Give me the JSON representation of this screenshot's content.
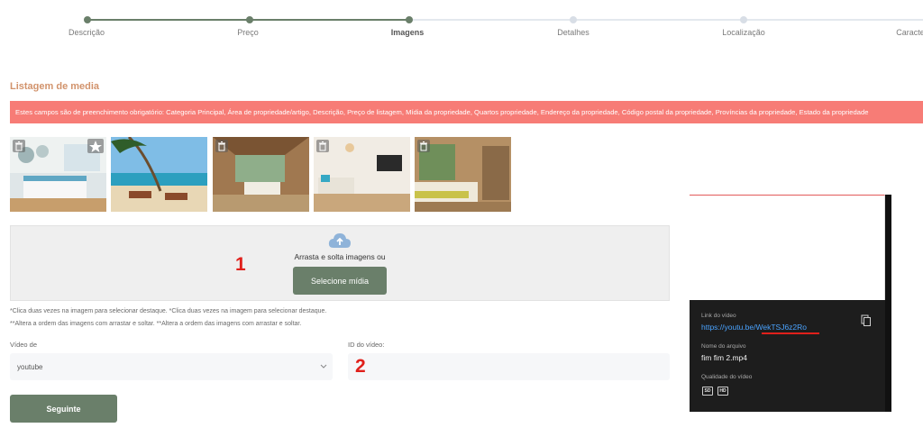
{
  "steps": [
    {
      "label": "Descrição",
      "state": "done"
    },
    {
      "label": "Preço",
      "state": "done"
    },
    {
      "label": "Imagens",
      "state": "active"
    },
    {
      "label": "Detalhes",
      "state": "todo"
    },
    {
      "label": "Localização",
      "state": "todo"
    },
    {
      "label": "Caracte",
      "state": "todo"
    }
  ],
  "section_title": "Listagem de media",
  "alert_text": "Estes campos são de preenchimento obrigatório: Categoria Principal, Área de propriedade/artigo, Descrição, Preço de listagem, Mídia da propriedade, Quartos propriedade, Endereço da propriedade, Código postal da propriedade, Províncias da propriedade, Estado da propriedade",
  "thumbnails": [
    {
      "icon": "bedroom-photo",
      "featured": true
    },
    {
      "icon": "beach-photo",
      "featured": false
    },
    {
      "icon": "room-photo",
      "featured": false
    },
    {
      "icon": "living-room-photo",
      "featured": false
    },
    {
      "icon": "bedroom-photo",
      "featured": false
    }
  ],
  "dropzone": {
    "text": "Arrasta e solta imagens ou",
    "button": "Selecione mídia",
    "icon": "cloud-upload-icon"
  },
  "hints": {
    "line1": "*Clica duas vezes na imagem para selecionar destaque. *Clica duas vezes na imagem para selecionar destaque.",
    "line2": "**Altera a ordem das imagens com arrastar e soltar. **Altera a ordem das imagens com arrastar e soltar."
  },
  "video_from": {
    "label": "Vídeo de",
    "value": "youtube"
  },
  "video_id": {
    "label": "ID do vídeo:",
    "value": ""
  },
  "next_button": "Seguinte",
  "annotations": {
    "one": "1",
    "two": "2"
  },
  "youtube_panel": {
    "link_label": "Link do vídeo",
    "link": "https://youtu.be/WekTSJ6z2Ro",
    "file_label": "Nome do arquivo",
    "file_name": "fim fim 2.mp4",
    "quality_label": "Qualidade do vídeo",
    "quality_badges": [
      "SD",
      "HD"
    ]
  },
  "colors": {
    "accent": "#6a7f6a",
    "alert": "#f77c76",
    "title": "#d2936c",
    "annotation": "#e0201b"
  }
}
